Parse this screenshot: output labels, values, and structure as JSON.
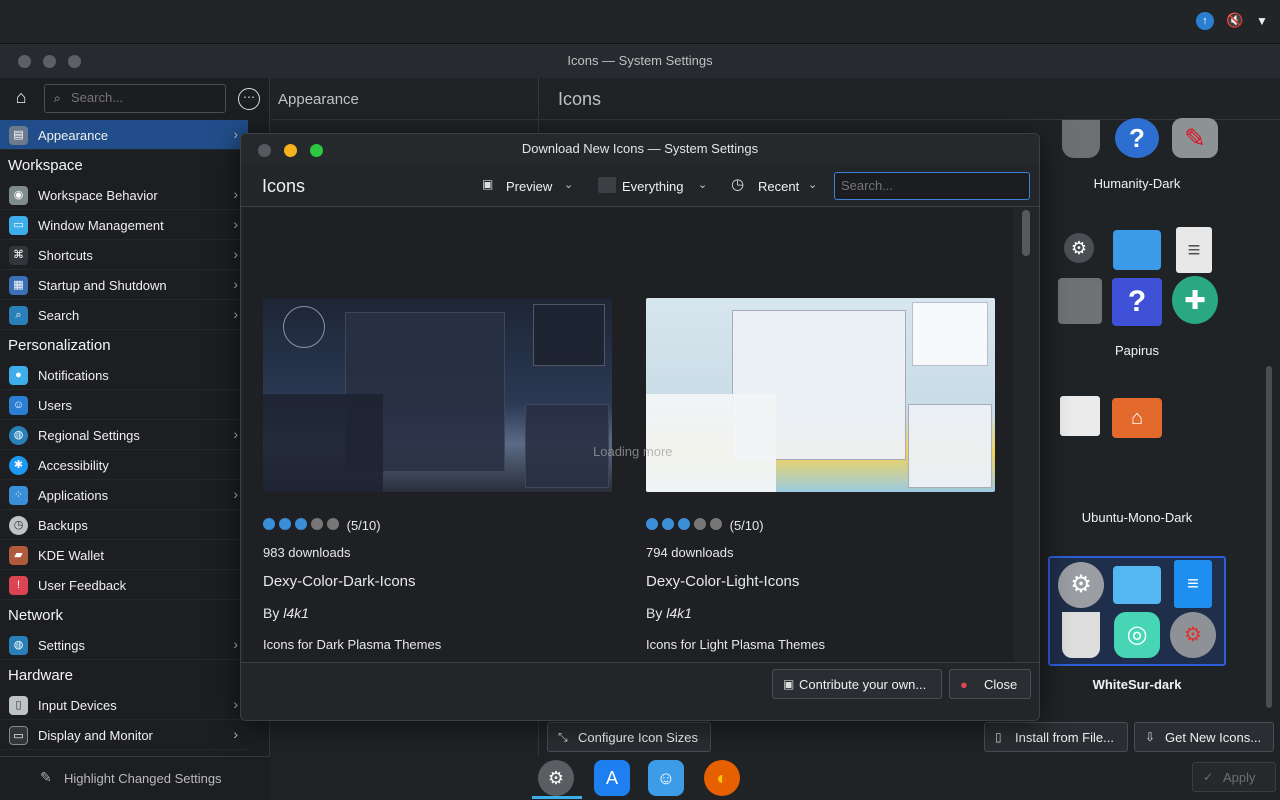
{
  "top_panel": {
    "info_glyph": "↑",
    "mute_glyph": "🔇",
    "menu_glyph": "▼"
  },
  "window": {
    "title": "Icons — System Settings"
  },
  "sidebar": {
    "search_placeholder": "Search...",
    "active": {
      "label": "Appearance"
    },
    "sections": [
      {
        "heading": "Workspace",
        "items": [
          "Workspace Behavior",
          "Window Management",
          "Shortcuts",
          "Startup and Shutdown",
          "Search"
        ]
      },
      {
        "heading": "Personalization",
        "items": [
          "Notifications",
          "Users",
          "Regional Settings",
          "Accessibility",
          "Applications",
          "Backups",
          "KDE Wallet",
          "User Feedback"
        ]
      },
      {
        "heading": "Network",
        "items": [
          "Settings"
        ]
      },
      {
        "heading": "Hardware",
        "items": [
          "Input Devices",
          "Display and Monitor"
        ]
      }
    ],
    "highlight_label": "Highlight Changed Settings"
  },
  "middle": {
    "heading": "Appearance"
  },
  "right": {
    "heading": "Icons",
    "themes": [
      "Humanity-Dark",
      "Papirus",
      "Ubuntu-Mono-Dark",
      "WhiteSur-dark"
    ],
    "buttons": {
      "configure": "Configure Icon Sizes",
      "install": "Install from File...",
      "get_new": "Get New Icons...",
      "apply": "Apply"
    }
  },
  "dialog": {
    "title": "Download New Icons — System Settings",
    "heading": "Icons",
    "view_dropdown": "Preview",
    "filter_dropdown": "Everything",
    "sort_dropdown": "Recent",
    "search_placeholder": "Search...",
    "loading_text": "Loading more",
    "cards": [
      {
        "rating": "(5/10)",
        "rating_value": 5,
        "downloads": "983 downloads",
        "name": "Dexy-Color-Dark-Icons",
        "by": "By",
        "author": "l4k1",
        "description": "Icons for Dark Plasma Themes"
      },
      {
        "rating": "(5/10)",
        "rating_value": 5,
        "downloads": "794 downloads",
        "name": "Dexy-Color-Light-Icons",
        "by": "By",
        "author": "l4k1",
        "description": "Icons for Light Plasma Themes"
      }
    ],
    "buttons": {
      "contribute": "Contribute your own...",
      "close": "Close"
    }
  },
  "colors": {
    "accent": "#2e5ed8",
    "active_row": "#214e8a",
    "close_red": "#da4453"
  }
}
